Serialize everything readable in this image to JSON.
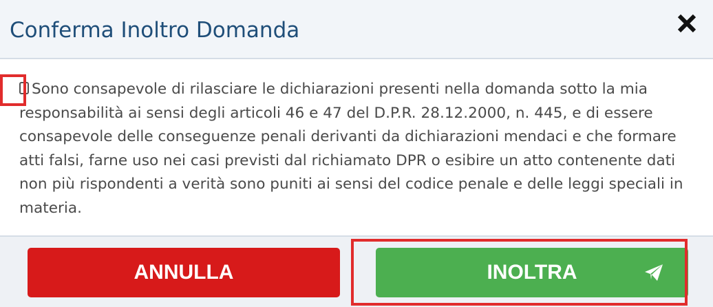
{
  "dialog": {
    "title": "Conferma Inoltro Domanda",
    "close_icon": "close-icon",
    "declaration_text": "Sono consapevole di rilasciare le dichiarazioni presenti nella domanda sotto la mia responsabilità ai sensi degli articoli 46 e 47 del D.P.R. 28.12.2000, n. 445, e di essere consapevole delle conseguenze penali derivanti da dichiarazioni mendaci e che formare atti falsi, farne uso nei casi previsti dal richiamato DPR o esibire un atto contenente dati non più rispondenti a verità sono puniti ai sensi del codice penale e delle leggi speciali in materia.",
    "checkbox_checked": false,
    "buttons": {
      "cancel_label": "ANNULLA",
      "submit_label": "INOLTRA",
      "submit_icon": "paper-plane-icon"
    }
  },
  "colors": {
    "title": "#1f4e79",
    "header_bg": "#f2f5f9",
    "cancel": "#d71a1a",
    "submit": "#4caf50",
    "highlight": "#e12c2c"
  }
}
